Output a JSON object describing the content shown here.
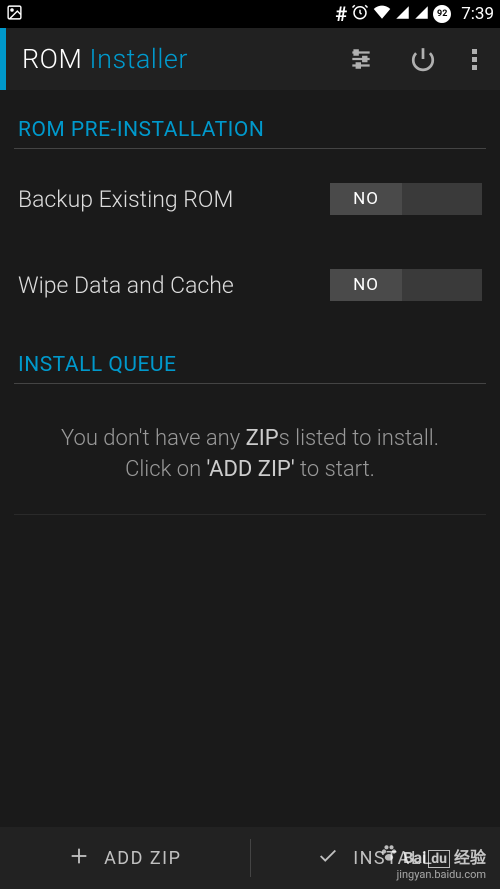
{
  "statusBar": {
    "time": "7:39",
    "battery": "92"
  },
  "appBar": {
    "titleMain": "ROM",
    "titleSub": "Installer"
  },
  "sections": {
    "preInstall": {
      "header": "ROM PRE-INSTALLATION",
      "backup": {
        "label": "Backup Existing ROM",
        "value": "NO"
      },
      "wipe": {
        "label": "Wipe Data and Cache",
        "value": "NO"
      }
    },
    "queue": {
      "header": "INSTALL QUEUE",
      "emptyLine1Pre": "You don't have any ",
      "emptyLine1Bold": "ZIP",
      "emptyLine1Post": "s listed to install.",
      "emptyLine2Pre": "Click on ",
      "emptyLine2Bold": "'ADD ZIP'",
      "emptyLine2Post": " to start."
    }
  },
  "bottomBar": {
    "addZip": "ADD ZIP",
    "install": "INSTALL"
  },
  "watermark": {
    "brand": "Bai",
    "suffix": "经验",
    "url": "jingyan.baidu.com"
  }
}
